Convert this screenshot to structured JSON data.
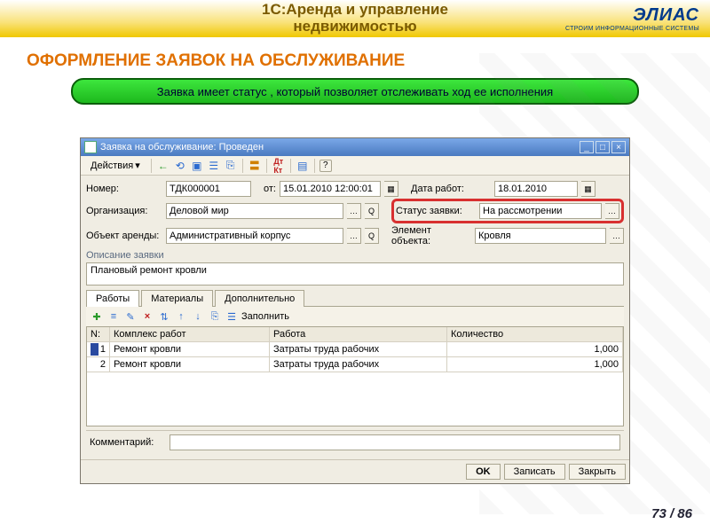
{
  "header": {
    "title_line1": "1С:Аренда и управление",
    "title_line2": "недвижимостью",
    "logo_main": "ЭЛИАС",
    "logo_sub": "СТРОИМ ИНФОРМАЦИОННЫЕ СИСТЕМЫ"
  },
  "section_title": "ОФОРМЛЕНИЕ ЗАЯВОК НА ОБСЛУЖИВАНИЕ",
  "banner": "Заявка имеет статус , который позволяет отслеживать ход ее исполнения",
  "window": {
    "title": "Заявка на обслуживание: Проведен",
    "actions_menu": "Действия",
    "labels": {
      "number": "Номер:",
      "from": "от:",
      "date_works": "Дата работ:",
      "organization": "Организация:",
      "status": "Статус заявки:",
      "object": "Объект аренды:",
      "element": "Элемент объекта:",
      "desc_group": "Описание заявки",
      "comment": "Комментарий:"
    },
    "fields": {
      "number": "ТДК000001",
      "date": "15.01.2010 12:00:01",
      "date_works": "18.01.2010",
      "organization": "Деловой мир",
      "status": "На рассмотрении",
      "object": "Административный корпус",
      "element": "Кровля",
      "description": "Плановый ремонт кровли",
      "comment": ""
    },
    "tabs": [
      "Работы",
      "Материалы",
      "Дополнительно"
    ],
    "fill_btn": "Заполнить",
    "grid": {
      "headers": {
        "n": "N:",
        "complex": "Комплекс работ",
        "work": "Работа",
        "qty": "Количество"
      },
      "rows": [
        {
          "n": "1",
          "complex": "Ремонт кровли",
          "work": "Затраты труда рабочих",
          "qty": "1,000"
        },
        {
          "n": "2",
          "complex": "Ремонт кровли",
          "work": "Затраты труда рабочих",
          "qty": "1,000"
        }
      ]
    },
    "buttons": {
      "ok": "OK",
      "save": "Записать",
      "close": "Закрыть"
    }
  },
  "pagenum": "73 / 86"
}
